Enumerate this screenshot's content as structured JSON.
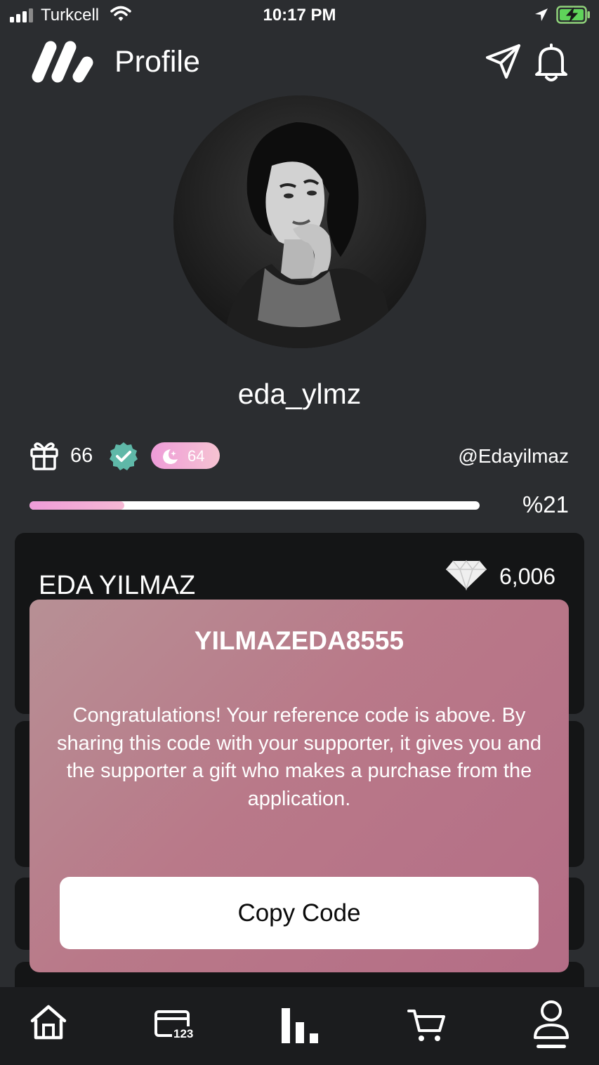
{
  "status_bar": {
    "carrier": "Turkcell",
    "time": "10:17 PM"
  },
  "header": {
    "title": "Profile"
  },
  "profile": {
    "username": "eda_ylmz",
    "gift_count": "66",
    "moon_count": "64",
    "handle": "@Edayilmaz",
    "progress_label": "%21",
    "progress_fraction": 0.21
  },
  "card": {
    "name": "EDA YILMAZ",
    "diamonds": "6,006"
  },
  "modal": {
    "code": "YILMAZEDA8555",
    "message": "Congratulations! Your reference code is above. By sharing this code with your supporter, it gives you and the supporter a gift who makes a purchase from the application.",
    "button_label": "Copy Code"
  },
  "tabbar": {
    "items": [
      "home-icon",
      "card-icon",
      "stats-icon",
      "cart-icon",
      "profile-icon"
    ],
    "card_icon_text": "123"
  },
  "colors": {
    "background": "#2b2d30",
    "card": "#141516",
    "modal_gradient_start": "#b79095",
    "modal_gradient_end": "#b46d86",
    "verified": "#5fb8a8",
    "progress_accent": "#ee9cd8"
  }
}
